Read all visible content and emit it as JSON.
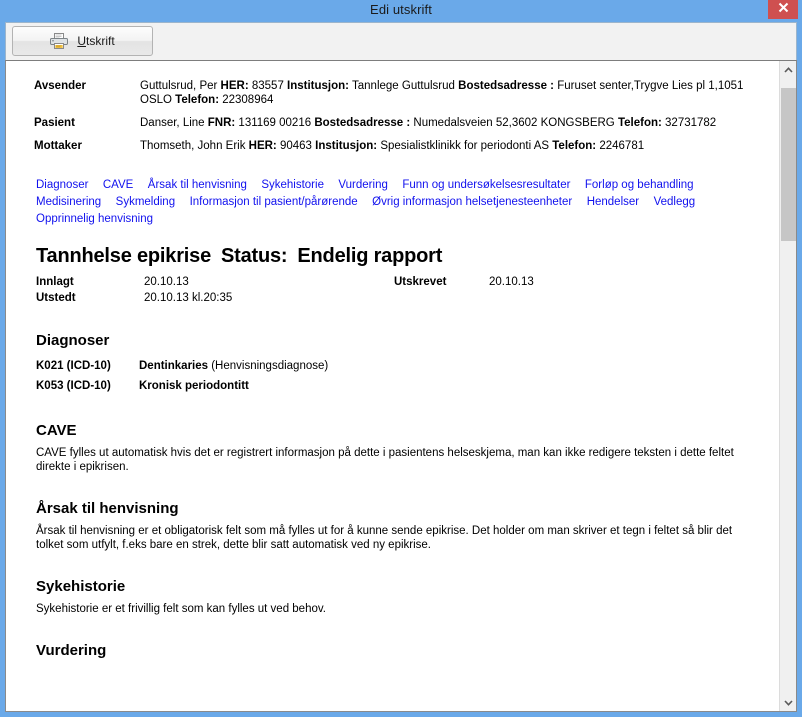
{
  "window": {
    "title": "Edi utskrift",
    "close_label": "✖"
  },
  "toolbar": {
    "print_button_label": "Utskrift",
    "print_button_accesskey": "U",
    "print_icon": "printer-icon"
  },
  "scrollbar": {
    "up_icon": "chevron-up-icon",
    "down_icon": "chevron-down-icon"
  },
  "document": {
    "meta": [
      {
        "label": "Avsender",
        "parts": [
          {
            "text": "Guttulsrud, Per ",
            "bold": false
          },
          {
            "text": "HER:",
            "bold": true
          },
          {
            "text": " 83557 ",
            "bold": false
          },
          {
            "text": "Institusjon:",
            "bold": true
          },
          {
            "text": " Tannlege Guttulsrud ",
            "bold": false
          },
          {
            "text": "Bostedsadresse :",
            "bold": true
          },
          {
            "text": " Furuset senter,Trygve Lies pl 1,1051 OSLO ",
            "bold": false
          },
          {
            "text": "Telefon:",
            "bold": true
          },
          {
            "text": " 22308964",
            "bold": false
          }
        ]
      },
      {
        "label": "Pasient",
        "parts": [
          {
            "text": "Danser, Line ",
            "bold": false
          },
          {
            "text": "FNR:",
            "bold": true
          },
          {
            "text": " 131169 00216  ",
            "bold": false
          },
          {
            "text": "Bostedsadresse :",
            "bold": true
          },
          {
            "text": " Numedalsveien 52,3602 KONGSBERG ",
            "bold": false
          },
          {
            "text": "Telefon:",
            "bold": true
          },
          {
            "text": " 32731782",
            "bold": false
          }
        ]
      },
      {
        "label": "Mottaker",
        "parts": [
          {
            "text": "Thomseth, John Erik ",
            "bold": false
          },
          {
            "text": "HER:",
            "bold": true
          },
          {
            "text": " 90463 ",
            "bold": false
          },
          {
            "text": "Institusjon:",
            "bold": true
          },
          {
            "text": " Spesialistklinikk for periodonti AS ",
            "bold": false
          },
          {
            "text": "Telefon:",
            "bold": true
          },
          {
            "text": " 2246781",
            "bold": false
          }
        ]
      }
    ],
    "nav_links": [
      "Diagnoser",
      "CAVE",
      "Årsak til henvisning",
      "Sykehistorie",
      "Vurdering",
      "Funn og undersøkelsesresultater",
      "Forløp og behandling",
      "Medisinering",
      "Sykmelding",
      "Informasjon til pasient/pårørende",
      "Øvrig informasjon helsetjenesteenheter",
      "Hendelser",
      "Vedlegg",
      "Opprinnelig henvisning"
    ],
    "title_main": "Tannhelse epikrise",
    "title_status_label": "Status:",
    "title_status_value": "Endelig rapport",
    "dates": {
      "innlagt_label": "Innlagt",
      "innlagt_value": "20.10.13",
      "utskrevet_label": "Utskrevet",
      "utskrevet_value": "20.10.13",
      "utstedt_label": "Utstedt",
      "utstedt_value": "20.10.13 kl.20:35"
    },
    "sections": {
      "diagnoser_heading": "Diagnoser",
      "diagnoser_rows": [
        {
          "code": "K021  (ICD-10)",
          "name": "Dentinkaries",
          "note": " (Henvisningsdiagnose)"
        },
        {
          "code": "K053  (ICD-10)",
          "name": "Kronisk periodontitt",
          "note": ""
        }
      ],
      "cave_heading": "CAVE",
      "cave_body": "CAVE fylles ut automatisk hvis det er registrert informasjon på dette i pasientens helseskjema, man kan ikke redigere teksten i dette feltet direkte i epikrisen.",
      "arsak_heading": "Årsak til henvisning",
      "arsak_body": "Årsak til henvisning er et obligatorisk felt som må fylles ut for å kunne sende epikrise. Det holder om man skriver et tegn i feltet så blir det tolket som utfylt, f.eks bare en strek, dette blir satt automatisk ved ny epikrise.",
      "syke_heading": "Sykehistorie",
      "syke_body": "Sykehistorie er et frivillig felt som kan fylles ut ved behov.",
      "vurdering_heading": "Vurdering"
    }
  },
  "colors": {
    "titlebar": "#6aa9e9",
    "close": "#cf5050",
    "link": "#1111ee",
    "page": "#ffffff"
  }
}
